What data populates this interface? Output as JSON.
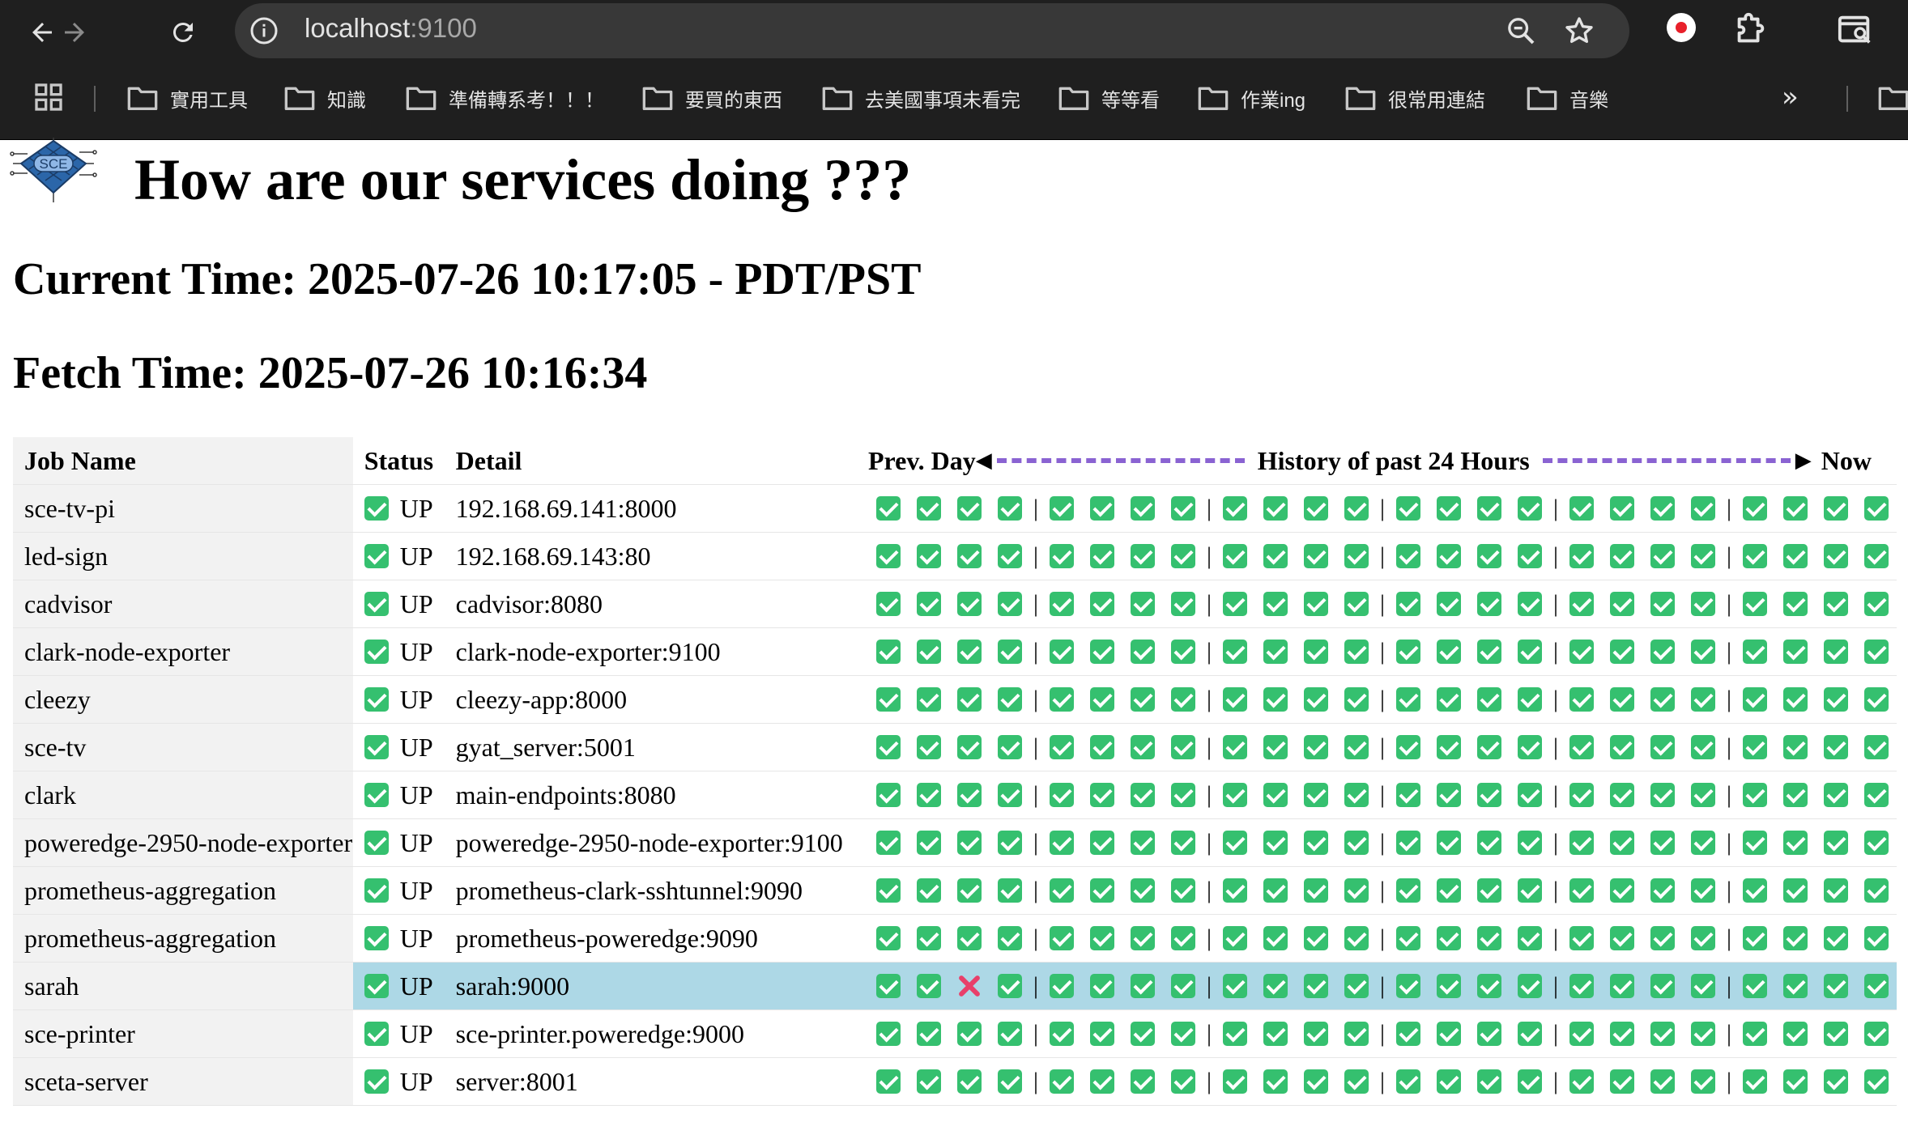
{
  "browser": {
    "url_host": "localhost",
    "url_port": ":9100",
    "bookmarks": [
      "實用工具",
      "知識",
      "準備轉系考！！！",
      "要買的東西",
      "去美國事項未看完",
      "等等看",
      "作業ing",
      "很常用連結",
      "音樂"
    ],
    "more": "»"
  },
  "page": {
    "logo_text": "SCE",
    "title": "How are our services doing ???",
    "current_time": "Current Time: 2025-07-26 10:17:05 - PDT/PST",
    "fetch_time": "Fetch Time: 2025-07-26 10:16:34"
  },
  "table": {
    "headers": {
      "job": "Job Name",
      "status": "Status",
      "detail": "Detail",
      "history_prev": "Prev. Day",
      "history_mid": "History of past 24 Hours",
      "history_now": "Now"
    },
    "rows": [
      {
        "job": "sce-tv-pi",
        "status": "UP",
        "detail": "192.168.69.141:8000",
        "history": [
          1,
          1,
          1,
          1,
          1,
          1,
          1,
          1,
          1,
          1,
          1,
          1,
          1,
          1,
          1,
          1,
          1,
          1,
          1,
          1,
          1,
          1,
          1,
          1
        ]
      },
      {
        "job": "led-sign",
        "status": "UP",
        "detail": "192.168.69.143:80",
        "history": [
          1,
          1,
          1,
          1,
          1,
          1,
          1,
          1,
          1,
          1,
          1,
          1,
          1,
          1,
          1,
          1,
          1,
          1,
          1,
          1,
          1,
          1,
          1,
          1
        ]
      },
      {
        "job": "cadvisor",
        "status": "UP",
        "detail": "cadvisor:8080",
        "history": [
          1,
          1,
          1,
          1,
          1,
          1,
          1,
          1,
          1,
          1,
          1,
          1,
          1,
          1,
          1,
          1,
          1,
          1,
          1,
          1,
          1,
          1,
          1,
          1
        ]
      },
      {
        "job": "clark-node-exporter",
        "status": "UP",
        "detail": "clark-node-exporter:9100",
        "history": [
          1,
          1,
          1,
          1,
          1,
          1,
          1,
          1,
          1,
          1,
          1,
          1,
          1,
          1,
          1,
          1,
          1,
          1,
          1,
          1,
          1,
          1,
          1,
          1
        ]
      },
      {
        "job": "cleezy",
        "status": "UP",
        "detail": "cleezy-app:8000",
        "history": [
          1,
          1,
          1,
          1,
          1,
          1,
          1,
          1,
          1,
          1,
          1,
          1,
          1,
          1,
          1,
          1,
          1,
          1,
          1,
          1,
          1,
          1,
          1,
          1
        ]
      },
      {
        "job": "sce-tv",
        "status": "UP",
        "detail": "gyat_server:5001",
        "history": [
          1,
          1,
          1,
          1,
          1,
          1,
          1,
          1,
          1,
          1,
          1,
          1,
          1,
          1,
          1,
          1,
          1,
          1,
          1,
          1,
          1,
          1,
          1,
          1
        ]
      },
      {
        "job": "clark",
        "status": "UP",
        "detail": "main-endpoints:8080",
        "history": [
          1,
          1,
          1,
          1,
          1,
          1,
          1,
          1,
          1,
          1,
          1,
          1,
          1,
          1,
          1,
          1,
          1,
          1,
          1,
          1,
          1,
          1,
          1,
          1
        ]
      },
      {
        "job": "poweredge-2950-node-exporter",
        "status": "UP",
        "detail": "poweredge-2950-node-exporter:9100",
        "history": [
          1,
          1,
          1,
          1,
          1,
          1,
          1,
          1,
          1,
          1,
          1,
          1,
          1,
          1,
          1,
          1,
          1,
          1,
          1,
          1,
          1,
          1,
          1,
          1
        ]
      },
      {
        "job": "prometheus-aggregation",
        "status": "UP",
        "detail": "prometheus-clark-sshtunnel:9090",
        "history": [
          1,
          1,
          1,
          1,
          1,
          1,
          1,
          1,
          1,
          1,
          1,
          1,
          1,
          1,
          1,
          1,
          1,
          1,
          1,
          1,
          1,
          1,
          1,
          1
        ]
      },
      {
        "job": "prometheus-aggregation",
        "status": "UP",
        "detail": "prometheus-poweredge:9090",
        "history": [
          1,
          1,
          1,
          1,
          1,
          1,
          1,
          1,
          1,
          1,
          1,
          1,
          1,
          1,
          1,
          1,
          1,
          1,
          1,
          1,
          1,
          1,
          1,
          1
        ]
      },
      {
        "job": "sarah",
        "status": "UP",
        "detail": "sarah:9000",
        "highlight": true,
        "history": [
          1,
          1,
          0,
          1,
          1,
          1,
          1,
          1,
          1,
          1,
          1,
          1,
          1,
          1,
          1,
          1,
          1,
          1,
          1,
          1,
          1,
          1,
          1,
          1
        ]
      },
      {
        "job": "sce-printer",
        "status": "UP",
        "detail": "sce-printer.poweredge:9000",
        "history": [
          1,
          1,
          1,
          1,
          1,
          1,
          1,
          1,
          1,
          1,
          1,
          1,
          1,
          1,
          1,
          1,
          1,
          1,
          1,
          1,
          1,
          1,
          1,
          1
        ]
      },
      {
        "job": "sceta-server",
        "status": "UP",
        "detail": "server:8001",
        "history": [
          1,
          1,
          1,
          1,
          1,
          1,
          1,
          1,
          1,
          1,
          1,
          1,
          1,
          1,
          1,
          1,
          1,
          1,
          1,
          1,
          1,
          1,
          1,
          1
        ]
      }
    ]
  },
  "colors": {
    "ok": "#35c06f",
    "fail": "#e8406a",
    "highlight": "#add8e6",
    "timeline_dash": "#8a63d2"
  }
}
